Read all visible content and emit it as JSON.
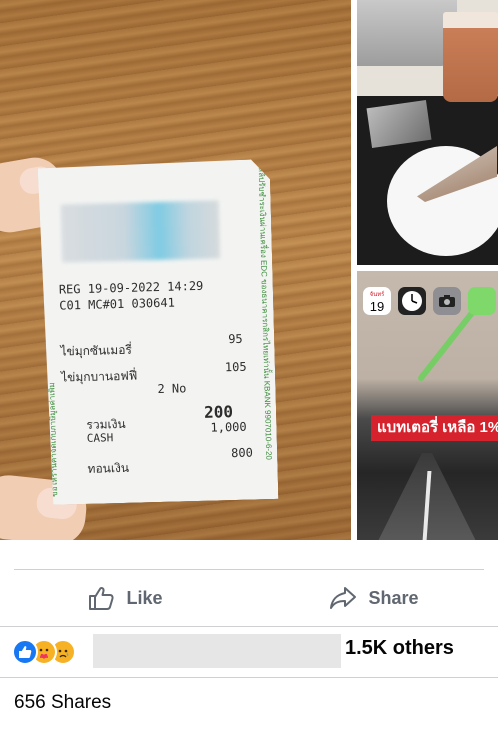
{
  "receipt": {
    "date_line": "REG   19-09-2022  14:29",
    "id_line": "C01      MC#01     030641",
    "item1_name": "ไข่มุกซันเมอรี่",
    "item1_price": "95",
    "item2_name": "ไข่มุกบานอฟฟี่",
    "item2_price": "105",
    "qty": "2 No",
    "total_label": "รวมเงิน",
    "total_value": "200",
    "cash_label": "CASH",
    "cash_value": "1,000",
    "change_label": "ทอนเงิน",
    "change_value": "800",
    "left_stripe": "ขอให้ร้านค้าจัดเก็บภาษีมูลค่าเพิ่ม",
    "right_stripe": "สลิปรับชำระเงินผ่านเครื่อง EDC ของธนาคารกสิกรไทยเท่านั้น KBANK 9907010-6-20"
  },
  "phone_screenshot": {
    "calendar_weekday": "จันทร์",
    "calendar_day": "19",
    "battery_banner": "แบทเตอรี่ เหลือ 1%"
  },
  "actions": {
    "like_label": "Like",
    "share_label": "Share"
  },
  "reactions": {
    "others_label": "1.5K others"
  },
  "shares": {
    "label": "656 Shares"
  },
  "colors": {
    "facebook_blue": "#1877f2",
    "action_gray": "#606770",
    "divider": "#ced0d4",
    "banner_red": "#d6222c"
  }
}
